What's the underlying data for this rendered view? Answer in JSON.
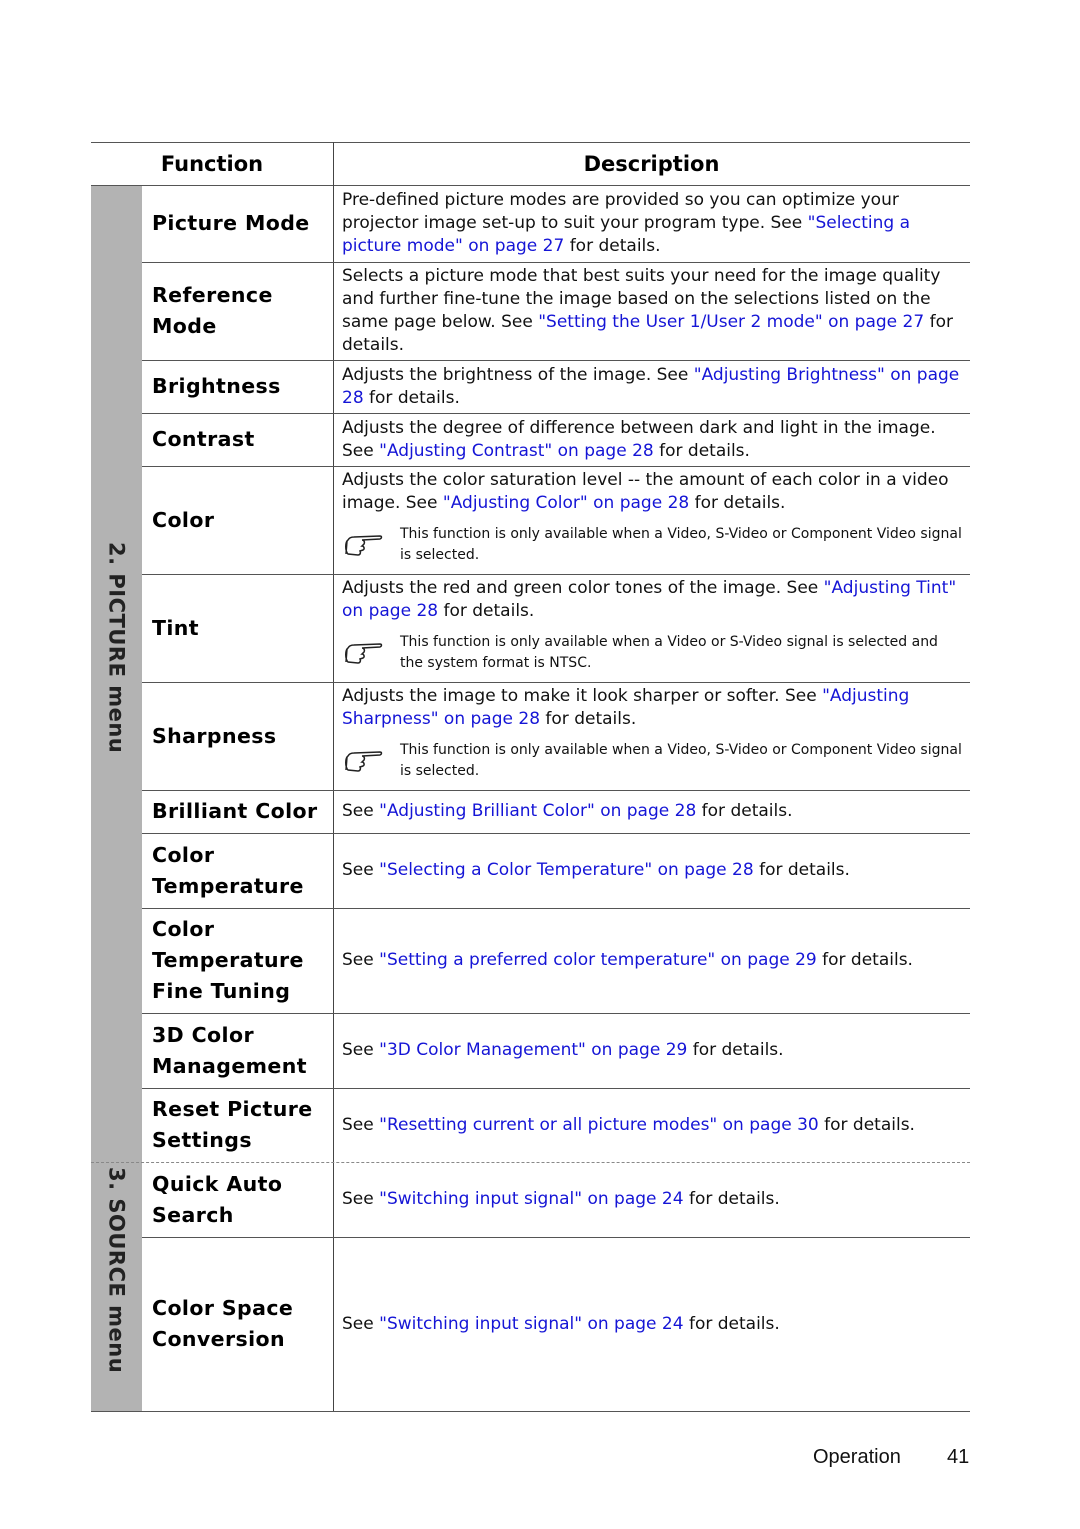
{
  "header": {
    "function": "Function",
    "description": "Description"
  },
  "sections": [
    {
      "label": "2. PICTURE menu"
    },
    {
      "label": "3. SOURCE menu"
    }
  ],
  "rows": [
    {
      "name": "Picture Mode",
      "pre": "Pre-defined picture modes are provided so you can optimize your projector image set-up to suit your program type. See ",
      "link": "\"Selecting a picture mode\" on page 27",
      "post": " for details.",
      "note": ""
    },
    {
      "name": "Reference Mode",
      "pre": "Selects a picture mode that best suits your need for the image quality and further fine-tune the image based on the selections listed on the same page below. See ",
      "link": "\"Setting the User 1/User 2 mode\" on page 27",
      "post": " for details.",
      "note": ""
    },
    {
      "name": "Brightness",
      "pre": "Adjusts the brightness of the image. See ",
      "link": "\"Adjusting Brightness\" on page 28",
      "post": " for details.",
      "note": ""
    },
    {
      "name": "Contrast",
      "pre": "Adjusts the degree of difference between dark and light in the image. See ",
      "link": "\"Adjusting Contrast\" on page 28",
      "post": " for details.",
      "note": ""
    },
    {
      "name": "Color",
      "pre": "Adjusts the color saturation level -- the amount of each color in a video image. See ",
      "link": "\"Adjusting Color\" on page 28",
      "post": " for details.",
      "note": "This function is only available when a Video, S-Video or Component Video signal is selected."
    },
    {
      "name": "Tint",
      "pre": "Adjusts the red and green color tones of the image. See ",
      "link": "\"Adjusting Tint\" on page 28",
      "post": " for details.",
      "note": "This function is only available when a Video or S-Video signal is selected and the system format is NTSC."
    },
    {
      "name": "Sharpness",
      "pre": "Adjusts the image to make it look sharper or softer. See ",
      "link": "\"Adjusting Sharpness\" on page 28",
      "post": " for details.",
      "note": "This function is only available when a Video, S-Video or Component Video signal is selected."
    },
    {
      "name": "Brilliant Color",
      "pre": "See ",
      "link": "\"Adjusting Brilliant Color\" on page 28",
      "post": " for details.",
      "note": ""
    },
    {
      "name": "Color Temperature",
      "pre": "See ",
      "link": "\"Selecting a Color Temperature\" on page 28",
      "post": " for details.",
      "note": ""
    },
    {
      "name": "Color Temperature Fine Tuning",
      "pre": "See ",
      "link": "\"Setting a preferred color temperature\" on page 29",
      "post": " for details.",
      "note": ""
    },
    {
      "name": "3D Color Management",
      "pre": "See ",
      "link": "\"3D Color Management\" on page 29",
      "post": " for details.",
      "note": ""
    },
    {
      "name": "Reset Picture Settings",
      "pre": "See ",
      "link": "\"Resetting current or all picture modes\" on page 30",
      "post": " for details.",
      "note": ""
    },
    {
      "name": "Quick Auto Search",
      "pre": "See ",
      "link": "\"Switching input signal\" on page 24",
      "post": " for details.",
      "note": ""
    },
    {
      "name": "Color Space Conversion",
      "pre": "See ",
      "link": "\"Switching input signal\" on page 24",
      "post": " for details.",
      "note": ""
    }
  ],
  "footer": {
    "section": "Operation",
    "page": "41"
  },
  "colors": {
    "link": "#1515d6",
    "sidebar": "#b3b3b3"
  }
}
